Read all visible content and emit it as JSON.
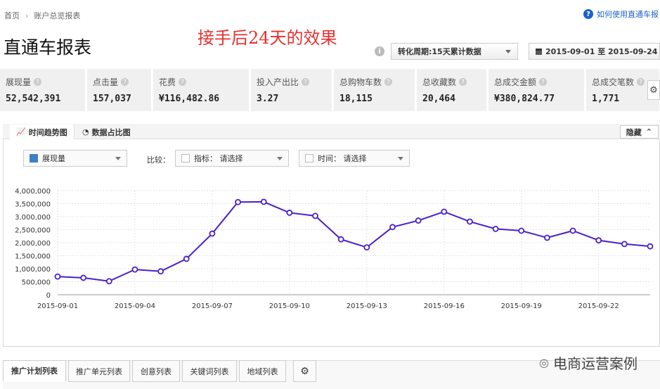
{
  "breadcrumb": {
    "home": "首页",
    "current": "账户总览报表"
  },
  "help_link": "如何使用直通车报",
  "page_title": "直通车报表",
  "overlay_text": "接手后24天的效果",
  "conversion_select": "转化周期:15天累计数据",
  "date_range": "2015-09-01 至 2015-09-24",
  "metrics": [
    {
      "label": "展现量",
      "value": "52,542,391"
    },
    {
      "label": "点击量",
      "value": "157,037"
    },
    {
      "label": "花费",
      "value": "¥116,482.86"
    },
    {
      "label": "投入产出比",
      "value": "3.27"
    },
    {
      "label": "总购物车数",
      "value": "18,115"
    },
    {
      "label": "总收藏数",
      "value": "20,464"
    },
    {
      "label": "总成交金额",
      "value": "¥380,824.77"
    },
    {
      "label": "总成交笔数",
      "value": "1,771"
    }
  ],
  "chart_tabs": {
    "trend": "时间趋势图",
    "ratio": "数据占比图",
    "hide": "隐藏"
  },
  "controls": {
    "metric_select": "展现量",
    "compare_label": "比较：",
    "indicator": "指标：  请选择",
    "time": "时间：  请选择"
  },
  "bottom_tabs": [
    "推广计划列表",
    "推广单元列表",
    "创意列表",
    "关键词列表",
    "地域列表"
  ],
  "watermark": "电商运营案例",
  "colors": {
    "line": "#4b1fc9",
    "accent": "#1a62c8",
    "overlay": "#e8302f"
  },
  "chart_data": {
    "type": "line",
    "series": [
      {
        "name": "",
        "values": [
          700000,
          650000,
          520000,
          970000,
          900000,
          1380000,
          2350000,
          3560000,
          3570000,
          3150000,
          3030000,
          2130000,
          1820000,
          2600000,
          2850000,
          3190000,
          2810000,
          2530000,
          2460000,
          2190000,
          2460000,
          2090000,
          1950000,
          1860000
        ]
      }
    ],
    "x": [
      "2015-09-01",
      "2015-09-02",
      "2015-09-03",
      "2015-09-04",
      "2015-09-05",
      "2015-09-06",
      "2015-09-07",
      "2015-09-08",
      "2015-09-09",
      "2015-09-10",
      "2015-09-11",
      "2015-09-12",
      "2015-09-13",
      "2015-09-14",
      "2015-09-15",
      "2015-09-16",
      "2015-09-17",
      "2015-09-18",
      "2015-09-19",
      "2015-09-20",
      "2015-09-21",
      "2015-09-22",
      "2015-09-23",
      "2015-09-24"
    ],
    "x_tick_labels": [
      "2015-09-01",
      "2015-09-04",
      "2015-09-07",
      "2015-09-10",
      "2015-09-13",
      "2015-09-16",
      "2015-09-19",
      "2015-09-22"
    ],
    "y_tick_labels": [
      "4,000,000",
      "3,500,000",
      "3,000,000",
      "2,500,000",
      "2,000,000",
      "1,500,000",
      "1,000,000",
      "500,000",
      "0"
    ],
    "ylim": [
      0,
      4000000
    ],
    "grid": true
  }
}
